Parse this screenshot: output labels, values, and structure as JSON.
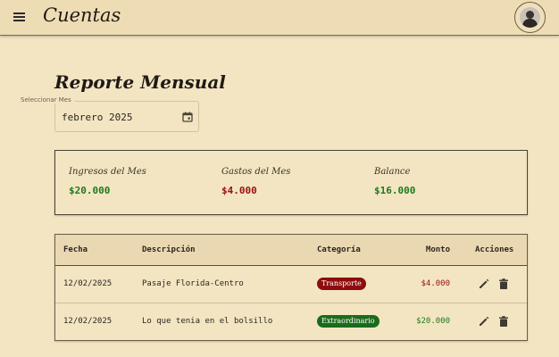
{
  "app": {
    "title": "Cuentas"
  },
  "page": {
    "title": "Reporte Mensual"
  },
  "month_picker": {
    "label": "Seleccionar Mes",
    "value": "febrero 2025"
  },
  "summary": {
    "income": {
      "label": "Ingresos del Mes",
      "value": "$20.000"
    },
    "expenses": {
      "label": "Gastos del Mes",
      "value": "$4.000"
    },
    "balance": {
      "label": "Balance",
      "value": "$16.000"
    }
  },
  "table": {
    "headers": [
      "Fecha",
      "Descripción",
      "Categoría",
      "Monto",
      "Acciones"
    ],
    "rows": [
      {
        "date": "12/02/2025",
        "description": "Pasaje Florida-Centro",
        "category": "Transporte",
        "amount": "$4.000"
      },
      {
        "date": "12/02/2025",
        "description": "Lo que tenia en el bolsillo",
        "category": "Extraordinario",
        "amount": "$20.000"
      }
    ]
  },
  "colors": {
    "background": "#f3e5c2",
    "income_green": "#1e7a1e",
    "expense_red": "#9a1010",
    "chip_red": "#8d0d0d",
    "chip_green": "#1b6b1b"
  },
  "icons": [
    "menu-icon",
    "avatar-icon",
    "calendar-icon",
    "edit-icon",
    "delete-icon"
  ]
}
